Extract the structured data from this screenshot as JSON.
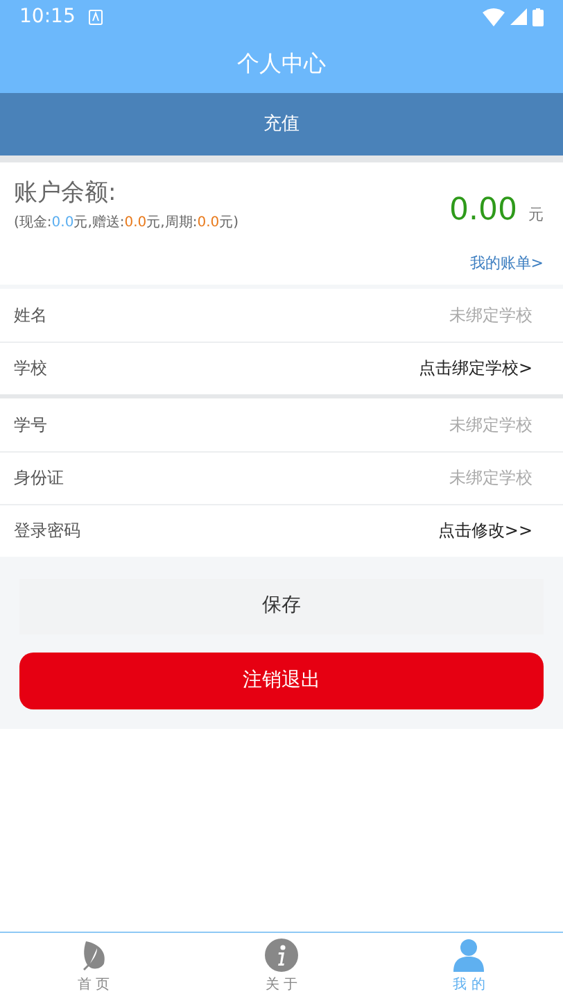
{
  "status_bar": {
    "time": "10:15"
  },
  "header": {
    "title": "个人中心"
  },
  "recharge": {
    "label": "充值"
  },
  "balance": {
    "label": "账户余额:",
    "amount": "0.00",
    "unit": "元",
    "breakdown": [
      {
        "kind": "label",
        "text": "(现金:"
      },
      {
        "kind": "cash",
        "text": "0.0"
      },
      {
        "kind": "label",
        "text": "元,赠送:"
      },
      {
        "kind": "bonus",
        "text": "0.0"
      },
      {
        "kind": "label",
        "text": "元,周期:"
      },
      {
        "kind": "bonus",
        "text": "0.0"
      },
      {
        "kind": "label",
        "text": "元)"
      }
    ],
    "bill_link": "我的账单>"
  },
  "sections": [
    [
      {
        "label": "姓名",
        "value": "未绑定学校",
        "kind": "value"
      },
      {
        "label": "学校",
        "value": "点击绑定学校>",
        "kind": "link"
      }
    ],
    [
      {
        "label": "学号",
        "value": "未绑定学校",
        "kind": "value"
      },
      {
        "label": "身份证",
        "value": "未绑定学校",
        "kind": "value"
      },
      {
        "label": "登录密码",
        "value": "点击修改>>",
        "kind": "link"
      }
    ]
  ],
  "save_button": "保存",
  "logout_button": "注销退出",
  "tabs": [
    {
      "label": "首 页",
      "kind": "leaf",
      "selected": false
    },
    {
      "label": "关 于",
      "kind": "info",
      "selected": false
    },
    {
      "label": "我 的",
      "kind": "person",
      "selected": true
    }
  ]
}
